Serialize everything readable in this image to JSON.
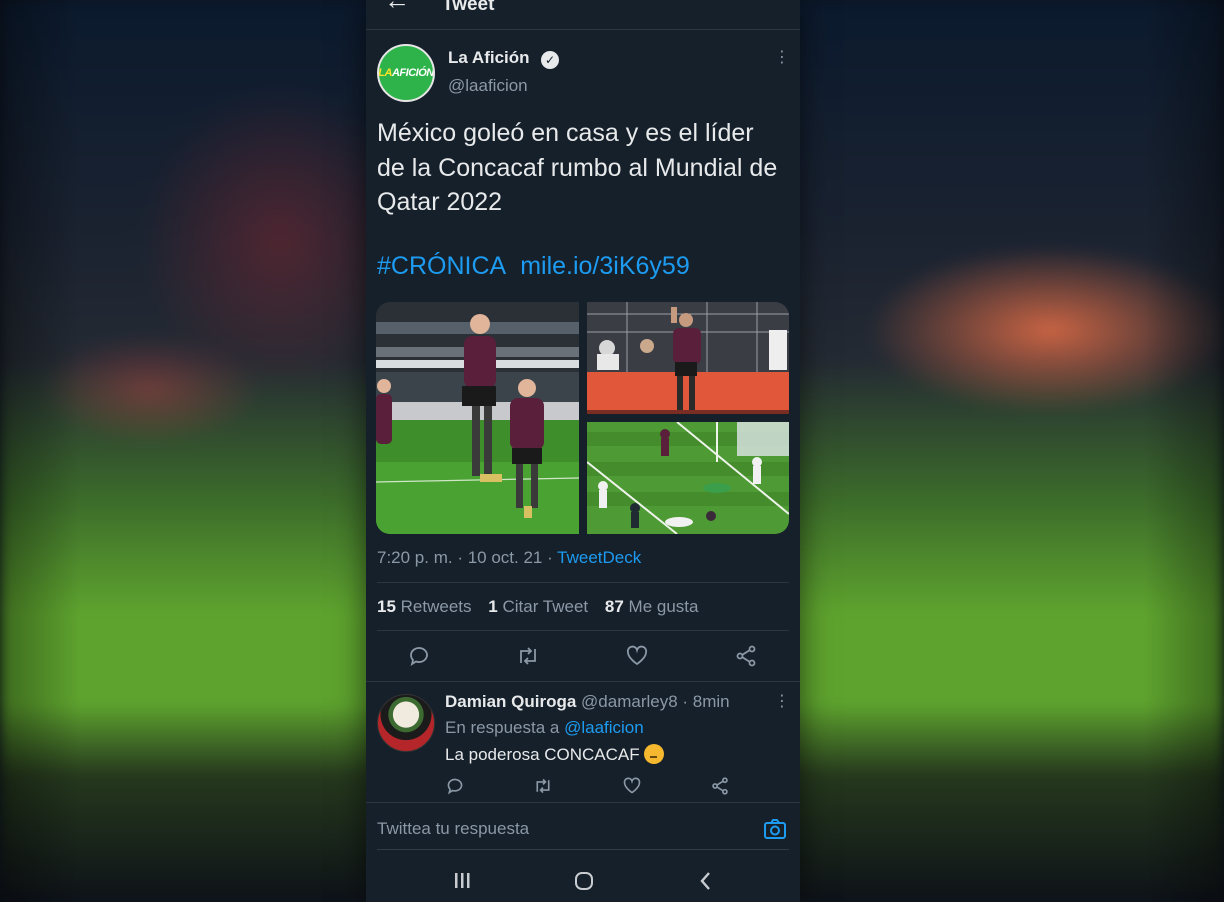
{
  "header": {
    "back_icon": "arrow-left-icon",
    "title": "Tweet"
  },
  "tweet": {
    "avatar_text_a": "LA",
    "avatar_text_b": "AFICIÓN",
    "name": "La Afición",
    "verified_icon": "verified-badge-icon",
    "handle": "@laaficion",
    "text": "México goleó en casa y es el líder de la Concacaf rumbo al Mundial de Qatar 2022",
    "hashtag": "#CRÓNICA",
    "link": "mile.io/3iK6y59",
    "time": "7:20 p. m. · 10 oct. 21 · ",
    "source": "TweetDeck",
    "retweets_count": "15",
    "retweets_label": "Retweets",
    "quotes_count": "1",
    "quotes_label": "Citar Tweet",
    "likes_count": "87",
    "likes_label": "Me gusta",
    "photos": [
      "photo-player-jumping",
      "photo-player-celebrating",
      "photo-goal-scene"
    ]
  },
  "reply": {
    "name": "Damian Quiroga",
    "meta": " @damarley8 · 8min",
    "reply_prefix": "En respuesta a ",
    "reply_mention": "@laaficion",
    "text": "La poderosa CONCACAF",
    "emoji": "thinking-face-icon"
  },
  "composer": {
    "placeholder": "Twittea tu respuesta",
    "camera_icon": "camera-icon"
  },
  "colors": {
    "background": "#15202b",
    "link": "#1d9bf0",
    "text": "#e7e9ea",
    "muted": "#8b98a5"
  }
}
